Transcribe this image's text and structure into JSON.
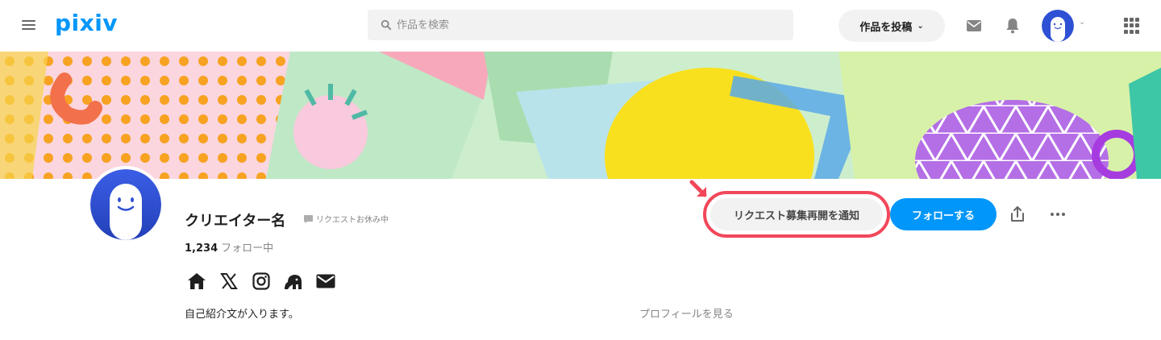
{
  "header": {
    "logo": "pixiv",
    "search_placeholder": "作品を検索",
    "post_button_label": "作品を投稿",
    "icons": [
      "menu-icon",
      "search-icon",
      "mail-icon",
      "bell-icon",
      "chevron-down-icon",
      "apps-grid-icon"
    ]
  },
  "profile": {
    "name": "クリエイター名",
    "request_status": "リクエストお休み中",
    "follow_count": "1,234",
    "follow_label": "フォロー中",
    "socials": [
      "home-icon",
      "x-icon",
      "instagram-icon",
      "mastodon-icon",
      "mail-icon"
    ],
    "bio": "自己紹介文が入ります。",
    "profile_link": "プロフィールを見る"
  },
  "actions": {
    "request_notify_label": "リクエスト募集再開を通知",
    "follow_label": "フォローする",
    "icons": [
      "share-icon",
      "more-icon"
    ]
  },
  "colors": {
    "brand": "#0096fa",
    "highlight": "#f2475a",
    "avatar_blue": "#2e50d4"
  }
}
